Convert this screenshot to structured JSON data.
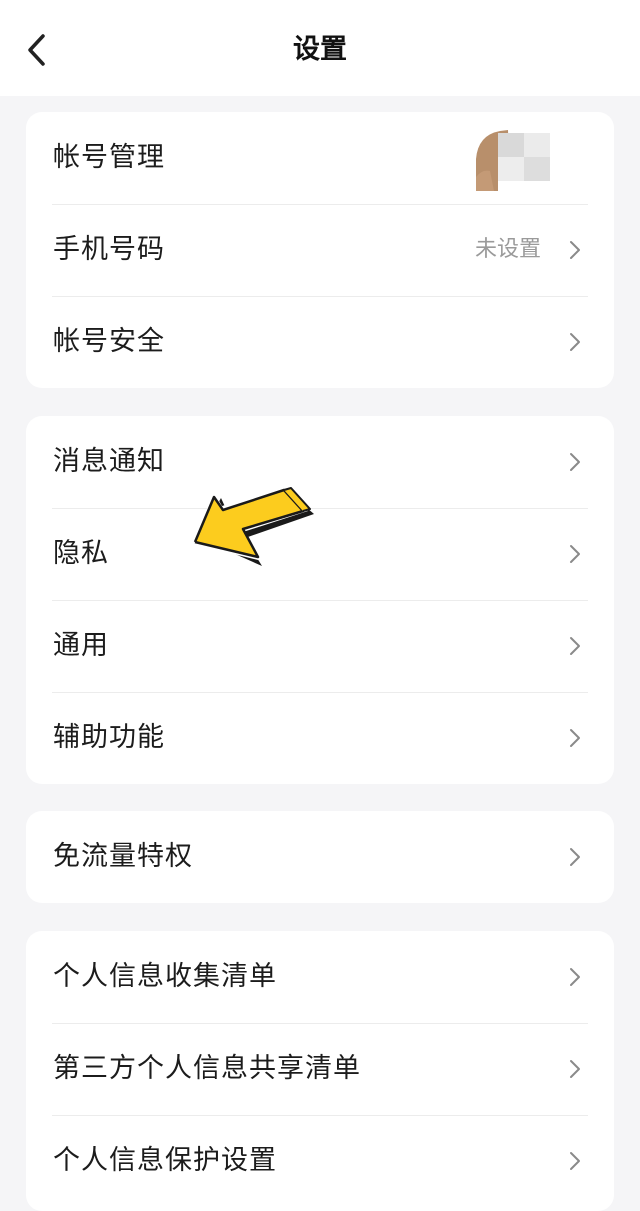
{
  "header": {
    "title": "设置"
  },
  "group_account": {
    "items": [
      {
        "label": "帐号管理",
        "value": "",
        "icon": "avatar"
      },
      {
        "label": "手机号码",
        "value": "未设置",
        "icon": "chevron-right-icon"
      },
      {
        "label": "帐号安全",
        "value": "",
        "icon": "chevron-right-icon"
      }
    ]
  },
  "group_general": {
    "items": [
      {
        "label": "消息通知",
        "icon": "chevron-right-icon"
      },
      {
        "label": "隐私",
        "icon": "chevron-right-icon"
      },
      {
        "label": "通用",
        "icon": "chevron-right-icon"
      },
      {
        "label": "辅助功能",
        "icon": "chevron-right-icon"
      }
    ]
  },
  "group_data": {
    "items": [
      {
        "label": "免流量特权",
        "icon": "chevron-right-icon"
      }
    ]
  },
  "group_info": {
    "items": [
      {
        "label": "个人信息收集清单",
        "icon": "chevron-right-icon"
      },
      {
        "label": "第三方个人信息共享清单",
        "icon": "chevron-right-icon"
      },
      {
        "label": "个人信息保护设置",
        "icon": "chevron-right-icon"
      }
    ]
  },
  "colors": {
    "background": "#f5f5f7",
    "card": "#ffffff",
    "annotation_arrow": "#fccc1e"
  }
}
